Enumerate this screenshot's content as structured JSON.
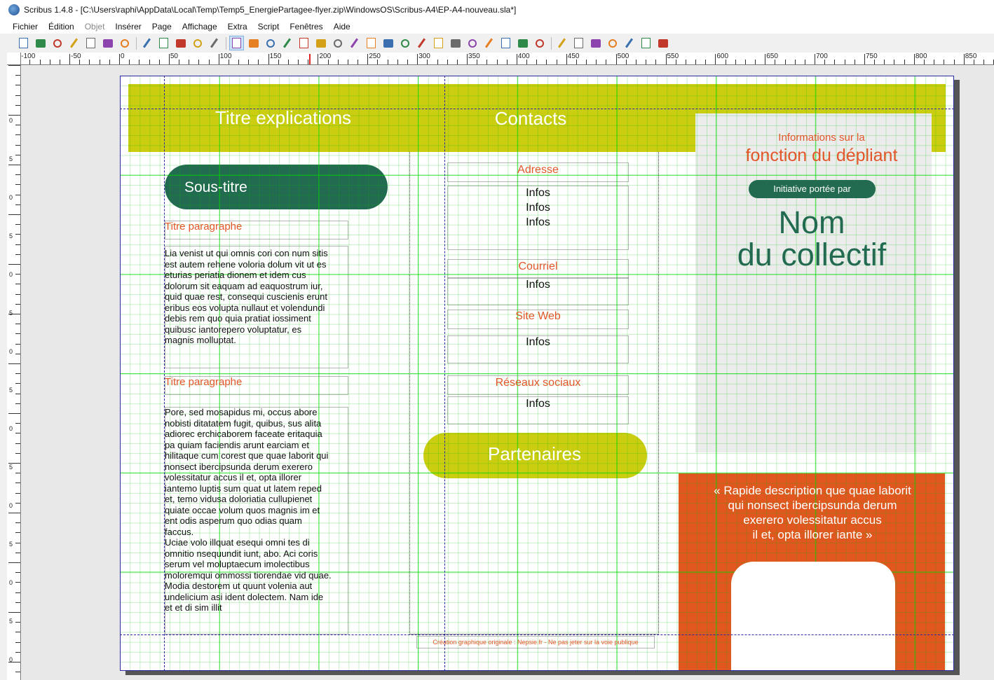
{
  "window": {
    "title": "Scribus 1.4.8 - [C:\\Users\\raphi\\AppData\\Local\\Temp\\Temp5_EnergiePartagee-flyer.zip\\WindowsOS\\Scribus-A4\\EP-A4-nouveau.sla*]"
  },
  "menu": [
    "Fichier",
    "Édition",
    "Objet",
    "Insérer",
    "Page",
    "Affichage",
    "Extra",
    "Script",
    "Fenêtres",
    "Aide"
  ],
  "toolbar": {
    "icons": [
      "new-document-icon",
      "open-icon",
      "save-icon",
      "close-icon",
      "print-icon",
      "preflight-icon",
      "export-pdf-icon",
      "undo-icon",
      "redo-icon",
      "cut-icon",
      "copy-icon",
      "paste-icon",
      "select-icon",
      "text-frame-icon",
      "image-frame-icon",
      "render-frame-icon",
      "table-icon",
      "shape-icon",
      "polygon-icon",
      "line-icon",
      "bezier-icon",
      "freehand-icon",
      "rotate-icon",
      "zoom-icon",
      "edit-contents-icon",
      "edit-text-icon",
      "link-frames-icon",
      "unlink-frames-icon",
      "measure-icon",
      "copy-properties-icon",
      "eyedropper-icon",
      "pdf-button-icon",
      "pdf-textfield-icon",
      "pdf-checkbox-icon",
      "pdf-combobox-icon",
      "pdf-listbox-icon",
      "pdf-annotation-icon",
      "pdf-link-icon"
    ]
  },
  "ruler": {
    "h_labels": [
      "-100",
      "-50",
      "0",
      "50",
      "100",
      "150",
      "200",
      "250",
      "300",
      "350",
      "400",
      "450",
      "500",
      "550",
      "600",
      "650",
      "700",
      "750",
      "800",
      "850"
    ],
    "v_labels": [
      "0",
      "5",
      "0",
      "5",
      "0",
      "5",
      "0",
      "5",
      "0",
      "5",
      "0",
      "5",
      "0",
      "5",
      "0"
    ]
  },
  "document": {
    "title_explications": "Titre explications",
    "title_contacts": "Contacts",
    "subtitle": "Sous-titre",
    "para1_title": "Titre paragraphe",
    "para1_body": "Lia venist ut qui omnis cori con num sitis\nest autem rehene voloria dolum vit ut es\neturias periatia dionem et idem cus\ndolorum sit eaquam ad eaquostrum iur,\nquid quae rest, consequi cuscienis erunt\neribus eos volupta nullaut et volendundi\ndebis rem quo quia pratiat iossiment\nquibusc iantorepero voluptatur, es\nmagnis molluptat.",
    "para2_title": "Titre paragraphe",
    "para2_body": "Pore, sed mosapidus mi, occus abore\nnobisti ditatatem fugit, quibus, sus alita\nadiorec erchicaborem faceate eritaquia\npa quiam faciendis arunt earciam et\nhilitaque cum corest que quae laborit qui\nnonsect ibercipsunda derum exerero\nvolessitatur accus il et, opta illorer\niantemo luptis sum quat ut latem reped\net, temo vidusa doloriatia cullupienet\nquiate occae volum quos magnis im et\nent odis asperum quo odias quam\nfaccus.\nUciae volo illquat esequi omni tes di\nomnitio nsequundit iunt, abo. Aci coris\nserum vel moluptaecum imolectibus\nmoloremqui ommossi tiorendae vid quae.\nModia destorem ut quunt volenia aut\nundelicium asi ident dolectem. Nam ide\net et di sim illit",
    "contacts": [
      {
        "label": "Adresse",
        "info": "Infos\nInfos\nInfos"
      },
      {
        "label": "Courriel",
        "info": "Infos"
      },
      {
        "label": "Site Web",
        "info": "Infos"
      },
      {
        "label": "Réseaux sociaux",
        "info": "Infos"
      }
    ],
    "partenaires": "Partenaires",
    "info_line1": "Informations sur la",
    "info_line2": "fonction du dépliant",
    "initiative": "Initiative portée par",
    "collectif": "Nom\ndu collectif",
    "quote": "« Rapide description que quae laborit\nqui nonsect ibercipsunda derum\nexerero volessitatur accus\nil et, opta illorer iante »",
    "credit": "Création graphique originale : Nepsie.fr - Ne pas jeter sur la voie publique"
  },
  "colors": {
    "lime": "#cbcd10",
    "dark_green": "#226b50",
    "orange": "#e2561f",
    "orange_text": "#e2562a",
    "grid_green": "#00dc00",
    "guide_blue": "#2a2aa0"
  }
}
